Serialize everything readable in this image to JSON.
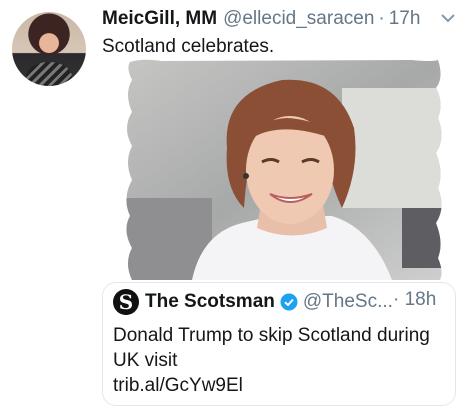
{
  "tweet": {
    "author_name": "MeicGill, MM",
    "handle": "@ellecid_saracen",
    "separator": "·",
    "time": "17h",
    "text": "Scotland celebrates."
  },
  "quoted": {
    "logo_letter": "S",
    "name": "The Scotsman",
    "handle": "@TheSc...",
    "separator": "·",
    "time": "18h",
    "text_line1": "Donald Trump to skip Scotland during",
    "text_line2": "UK visit",
    "link": "trib.al/GcYw9El"
  },
  "icons": {
    "caret": "chevron-down-icon",
    "verified": "verified-badge-icon",
    "logo": "scotsman-logo-icon"
  },
  "colors": {
    "text": "#14171a",
    "secondary": "#657786",
    "border": "#e1e8ed",
    "verified": "#1da1f2"
  }
}
